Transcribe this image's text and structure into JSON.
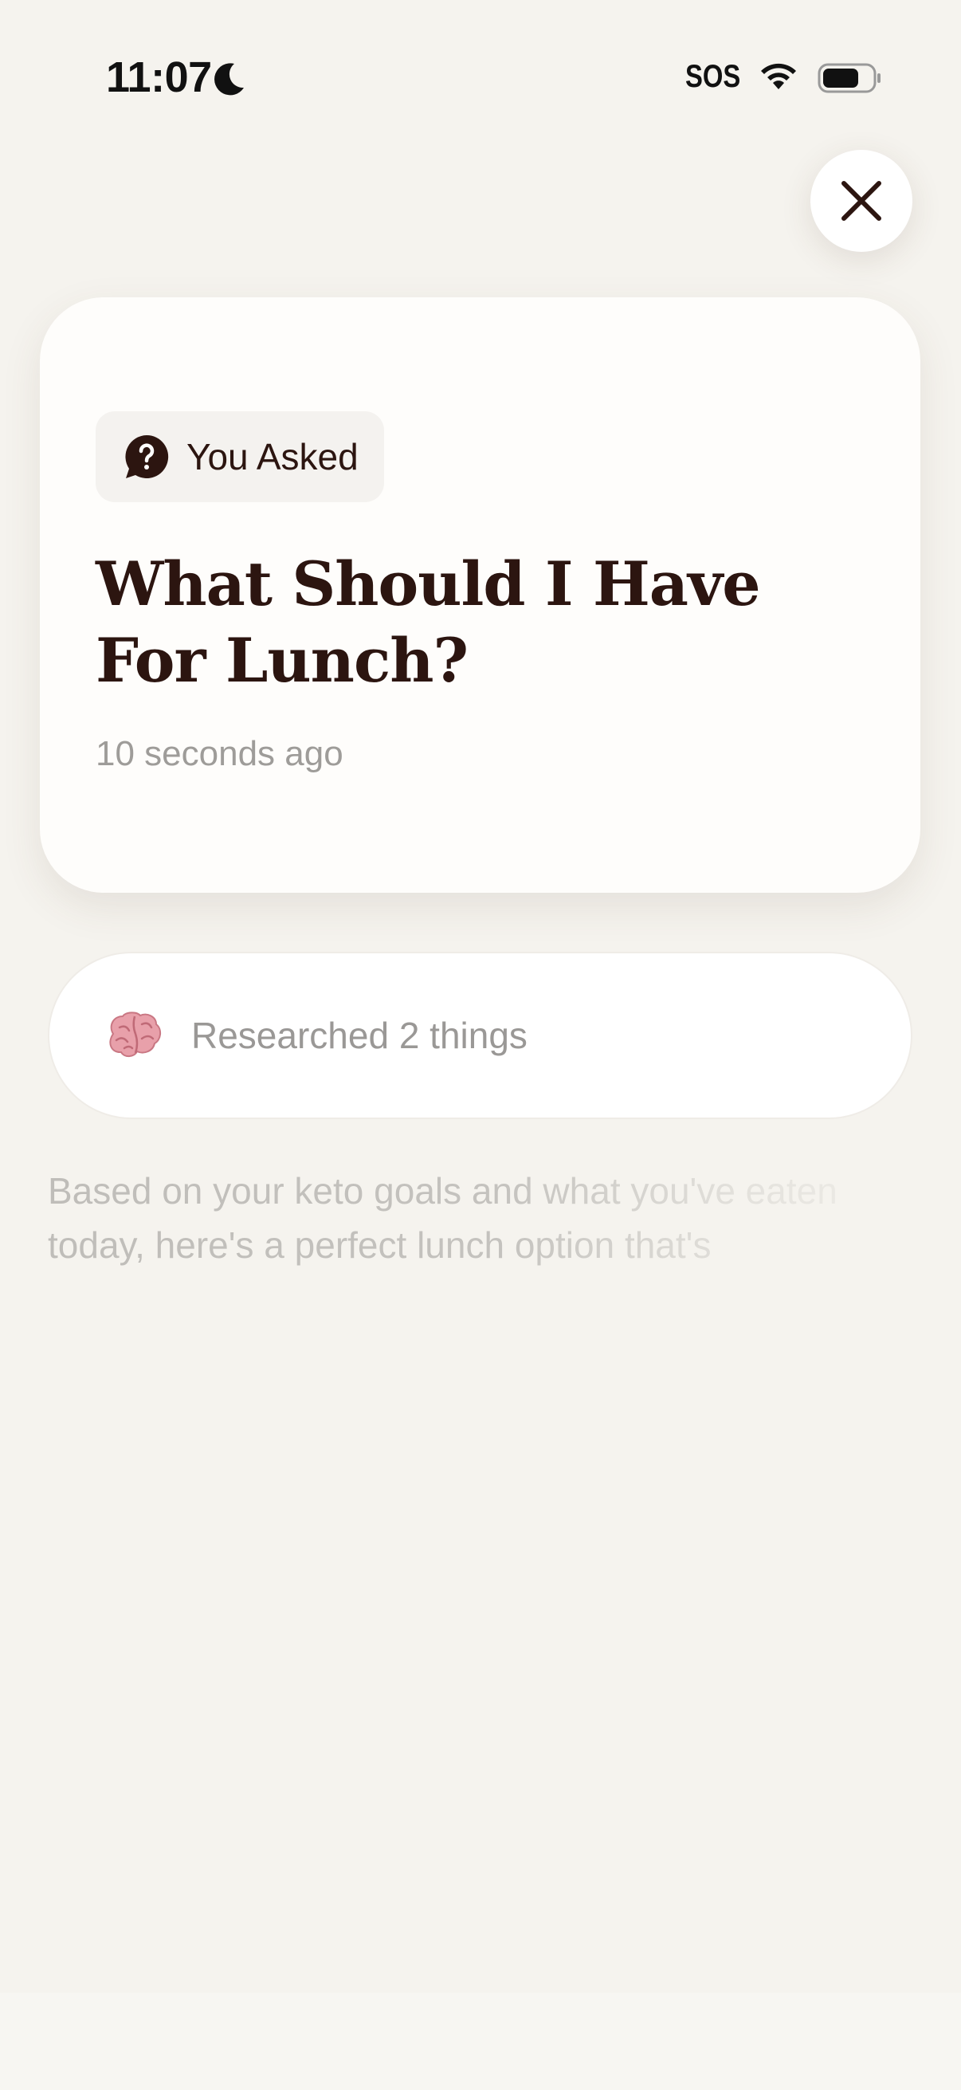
{
  "status_bar": {
    "time": "11:07",
    "carrier_status": "SOS",
    "icons": [
      "moon-icon",
      "wifi-icon",
      "battery-icon"
    ]
  },
  "close_button": {
    "icon": "close-icon"
  },
  "question_card": {
    "badge_icon": "question-bubble-icon",
    "badge_label": "You Asked",
    "title": "What Should I Have For Lunch?",
    "timestamp": "10 seconds ago"
  },
  "research": {
    "icon": "brain-icon",
    "label": "Researched 2 things"
  },
  "answer": {
    "text": "Based on your keto goals and what you've eaten today, here's a perfect lunch option that's"
  },
  "colors": {
    "background": "#f5f3ee",
    "card": "#fefdfb",
    "title_text": "#2c1510",
    "muted_text": "#9e9c99",
    "brain_pink": "#e8a0aa"
  }
}
